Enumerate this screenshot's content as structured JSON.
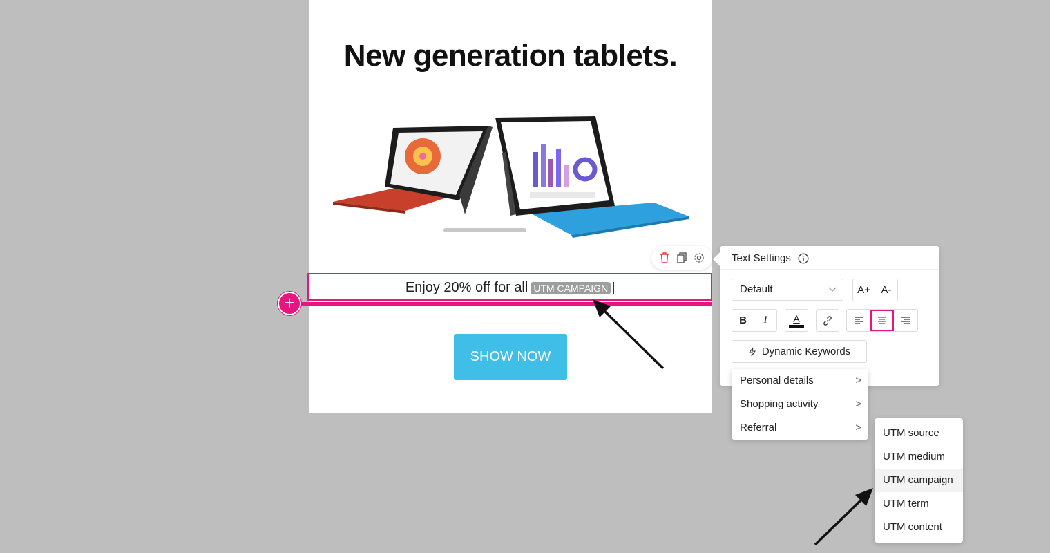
{
  "canvas": {
    "headline": "New generation tablets.",
    "body_text": "Enjoy 20% off for all",
    "keyword_tag": "UTM CAMPAIGN",
    "cta_label": "SHOW NOW",
    "add_symbol": "+"
  },
  "block_toolbar": {
    "icons": [
      "trash-icon",
      "duplicate-icon",
      "gear-icon"
    ]
  },
  "text_settings": {
    "title": "Text Settings",
    "font_select": "Default",
    "size_up": "A+",
    "size_down": "A-",
    "bold": "B",
    "italic": "I",
    "color_letter": "A",
    "align_active": "center",
    "dynamic_keywords_label": "Dynamic Keywords"
  },
  "keyword_menu": {
    "items": [
      {
        "label": "Personal details"
      },
      {
        "label": "Shopping activity"
      },
      {
        "label": "Referral"
      }
    ]
  },
  "utm_menu": {
    "items": [
      {
        "label": "UTM source"
      },
      {
        "label": "UTM medium"
      },
      {
        "label": "UTM campaign"
      },
      {
        "label": "UTM term"
      },
      {
        "label": "UTM content"
      }
    ],
    "highlighted": "UTM campaign"
  },
  "colors": {
    "accent": "#e6157f",
    "cta": "#3fbee8",
    "tag": "#9d9d9d",
    "background": "#bebebe"
  }
}
